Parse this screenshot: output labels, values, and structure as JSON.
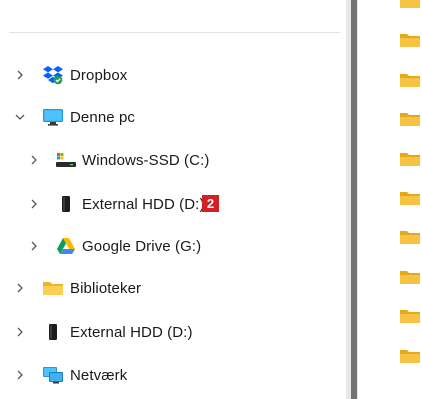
{
  "nav": {
    "items": [
      {
        "label": "Dropbox",
        "icon": "dropbox-icon",
        "chevron": "right",
        "level": 0
      },
      {
        "label": "Denne pc",
        "icon": "monitor-icon",
        "chevron": "down",
        "level": 0
      },
      {
        "label": "Windows-SSD (C:)",
        "icon": "drive-icon",
        "chevron": "right",
        "level": 1
      },
      {
        "label": "External HDD (D:)",
        "icon": "external-drive-icon",
        "chevron": "right",
        "level": 1,
        "badge": "2"
      },
      {
        "label": "Google Drive (G:)",
        "icon": "google-drive-icon",
        "chevron": "right",
        "level": 1
      },
      {
        "label": "Biblioteker",
        "icon": "folder-icon",
        "chevron": "right",
        "level": 0
      },
      {
        "label": "External HDD (D:)",
        "icon": "external-drive-icon",
        "chevron": "right",
        "level": 0
      },
      {
        "label": "Netværk",
        "icon": "network-icon",
        "chevron": "right",
        "level": 0
      }
    ]
  },
  "content": {
    "folder_count": 10
  },
  "colors": {
    "folder": "#f6c342",
    "badge": "#d32025",
    "dropbox": "#0061fe",
    "monitor": "#1e9be0",
    "scrollbar_thumb": "#737373"
  }
}
